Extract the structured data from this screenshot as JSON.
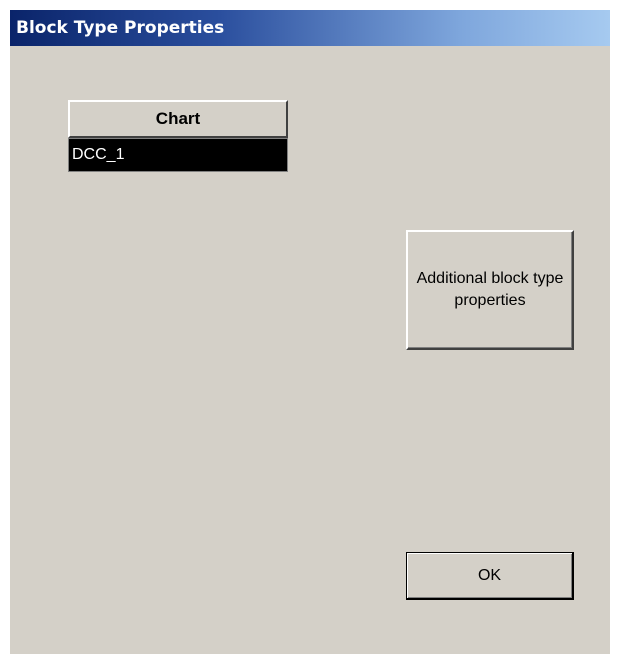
{
  "window": {
    "title": "Block Type Properties"
  },
  "chart_table": {
    "header": "Chart",
    "rows": [
      "DCC_1"
    ]
  },
  "buttons": {
    "additional_label": "Additional block type properties",
    "ok_label": "OK"
  },
  "colors": {
    "title_gradient_start": "#0a246a",
    "title_gradient_end": "#a6caf0",
    "window_background": "#d4d0c8",
    "selected_row_background": "#000000",
    "selected_row_text": "#ffffff"
  }
}
